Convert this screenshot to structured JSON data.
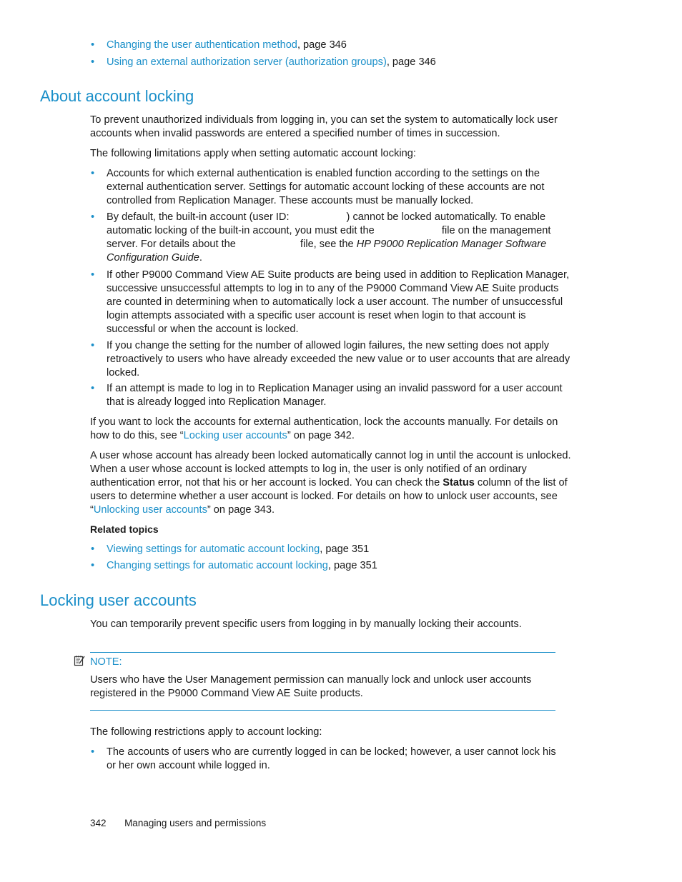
{
  "top_links": [
    {
      "link": "Changing the user authentication method",
      "suffix": ", page 346"
    },
    {
      "link": "Using an external authorization server (authorization groups)",
      "suffix": ", page 346"
    }
  ],
  "section1": {
    "title": "About account locking",
    "intro": "To prevent unauthorized individuals from logging in, you can set the system to automatically lock user accounts when invalid passwords are entered a specified number of times in succession.",
    "limitations_intro": "The following limitations apply when setting automatic account locking:",
    "bullets": [
      {
        "text": "Accounts for which external authentication is enabled function according to the settings on the external authentication server. Settings for automatic account locking of these accounts are not controlled from Replication Manager. These accounts must be manually locked."
      },
      {
        "p1": "By default, the built-in account (user ID:",
        "p2": ") cannot be locked automatically. To enable automatic locking of the built-in account, you must edit the",
        "p3": "file on the management server. For details about the",
        "p4": "file, see the",
        "italic": "HP P9000 Replication Manager Software Configuration Guide",
        "p5": "."
      },
      {
        "text": "If other P9000 Command View AE Suite products are being used in addition to Replication Manager, successive unsuccessful attempts to log in to any of the P9000 Command View AE Suite products are counted in determining when to automatically lock a user account. The number of unsuccessful login attempts associated with a specific user account is reset when login to that account is successful or when the account is locked."
      },
      {
        "text": "If you change the setting for the number of allowed login failures, the new setting does not apply retroactively to users who have already exceeded the new value or to user accounts that are already locked."
      },
      {
        "text": "If an attempt is made to log in to Replication Manager using an invalid password for a user account that is already logged into Replication Manager."
      }
    ],
    "external_para": {
      "before": "If you want to lock the accounts for external authentication, lock the accounts manually. For details on how to do this, see “",
      "link": "Locking user accounts",
      "after": "” on page 342."
    },
    "locked_para": {
      "before": "A user whose account has already been locked automatically cannot log in until the account is unlocked. When a user whose account is locked attempts to log in, the user is only notified of an ordinary authentication error, not that his or her account is locked.  You can check the ",
      "bold": "Status",
      "middle": " column of the list of users to determine whether a user account is locked. For details on how to unlock user accounts, see “",
      "link": "Unlocking user accounts",
      "after": "” on page 343."
    },
    "related_heading": "Related topics",
    "related": [
      {
        "link": "Viewing settings for automatic account locking",
        "suffix": ", page 351"
      },
      {
        "link": "Changing settings for automatic account locking",
        "suffix": ", page 351"
      }
    ]
  },
  "section2": {
    "title": "Locking user accounts",
    "intro": "You can temporarily prevent specific users from logging in by manually locking their accounts.",
    "note_label": "NOTE:",
    "note_text": "Users who have the User Management permission can manually lock and unlock user accounts registered in the P9000 Command View AE Suite products.",
    "restrictions_intro": "The following restrictions apply to account locking:",
    "bullets": [
      {
        "text": "The accounts of users who are currently logged in can be locked; however, a user cannot lock his or her own account while logged in."
      }
    ]
  },
  "footer": {
    "page_number": "342",
    "chapter": "Managing users and permissions"
  },
  "bullet_char": "•"
}
